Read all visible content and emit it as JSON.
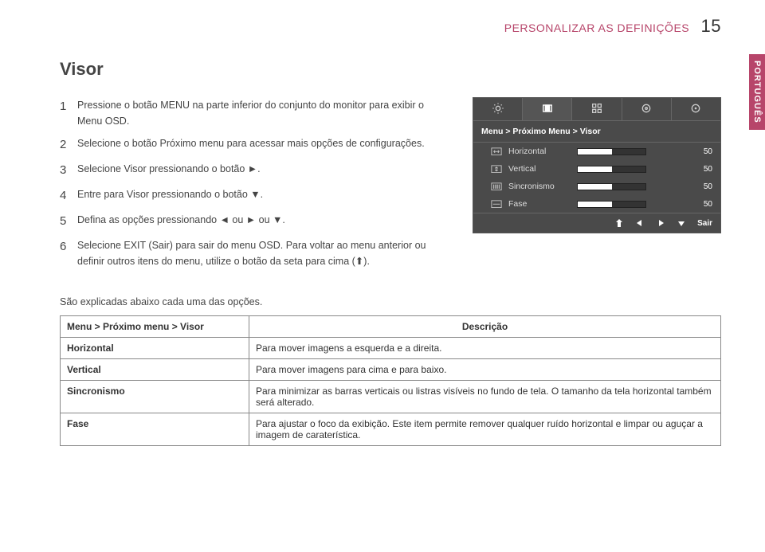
{
  "header": {
    "breadcrumb": "PERSONALIZAR AS DEFINIÇÕES",
    "page_number": "15"
  },
  "side_tab": "PORTUGUÊS",
  "section_title": "Visor",
  "steps": [
    {
      "n": "1",
      "text": "Pressione o botão MENU na parte inferior do conjunto do monitor para exibir o Menu OSD."
    },
    {
      "n": "2",
      "text": "Selecione o botão Próximo menu para acessar mais opções de configurações."
    },
    {
      "n": "3",
      "text": "Selecione Visor pressionando o botão ►."
    },
    {
      "n": "4",
      "text": "Entre para Visor pressionando o botão ▼."
    },
    {
      "n": "5",
      "text": "Defina as opções pressionando ◄ ou ► ou ▼."
    },
    {
      "n": "6",
      "text": "Selecione EXIT (Sair) para sair do menu OSD. Para voltar ao menu anterior ou definir outros itens do menu, utilize o botão da seta para cima (⬆)."
    }
  ],
  "osd": {
    "tabs": [
      "brightness",
      "display",
      "color",
      "other1",
      "other2"
    ],
    "breadcrumb": "Menu  >  Próximo Menu  >  Visor",
    "rows": [
      {
        "label": "Horizontal",
        "value": "50"
      },
      {
        "label": "Vertical",
        "value": "50"
      },
      {
        "label": "Sincronismo",
        "value": "50"
      },
      {
        "label": "Fase",
        "value": "50"
      }
    ],
    "exit_label": "Sair"
  },
  "explain_intro": "São explicadas abaixo cada uma das opções.",
  "table": {
    "header_left": "Menu > Próximo menu > Visor",
    "header_right": "Descrição",
    "rows": [
      {
        "name": "Horizontal",
        "desc": "Para mover imagens a esquerda e a direita."
      },
      {
        "name": "Vertical",
        "desc": "Para mover imagens para cima e para baixo."
      },
      {
        "name": "Sincronismo",
        "desc": "Para minimizar as barras verticais ou listras visíveis no fundo de tela. O tamanho da tela horizontal também será alterado."
      },
      {
        "name": "Fase",
        "desc": "Para ajustar o foco da exibição. Este item permite remover qualquer ruído horizontal e limpar ou aguçar a imagem de caraterística."
      }
    ]
  }
}
